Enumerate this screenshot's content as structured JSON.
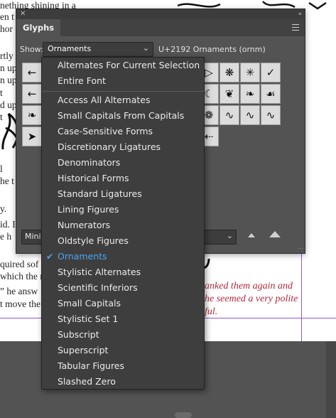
{
  "document": {
    "left_lines": [
      "nething shining in a",
      "en t",
      "hor",
      "rtly",
      "n up",
      "n up",
      "t",
      "d up",
      "t",
      "l",
      "he t",
      "y.",
      "id. I",
      "e h",
      "quired sof",
      "which the r",
      "” he answ",
      "t move the"
    ],
    "red_lines": [
      "anked them again and",
      "he seemed a very polite",
      "ful."
    ]
  },
  "panel": {
    "tab_label": "Glyphs",
    "close_glyph": "✕",
    "collapse_glyph": "«",
    "show_label": "Show:",
    "show_value": "Ornaments",
    "unicode_info": "U+2192 Ornaments (ornm)",
    "font_name": "Minic",
    "icons": {
      "menu": "panel-menu-icon",
      "zoom_out": "small-mountain-icon",
      "zoom_in": "large-mountain-icon"
    },
    "glyph_rows": [
      [
        "←",
        "",
        "",
        "",
        "",
        "",
        "",
        "",
        "▷",
        "❋",
        "✳",
        "✓"
      ],
      [
        "←",
        "",
        "",
        "",
        "",
        "",
        "",
        "",
        "☾",
        "❦",
        "❧",
        "☙"
      ],
      [
        "❧",
        "",
        "",
        "",
        "",
        "",
        "",
        "",
        "❁",
        "∿",
        "∿",
        "∿"
      ],
      [
        "➤",
        "",
        "",
        "",
        "",
        "",
        "",
        "",
        "⇠"
      ]
    ]
  },
  "dropdown": {
    "group1": [
      "Alternates For Current Selection",
      "Entire Font"
    ],
    "group2": [
      "Access All Alternates",
      "Small Capitals From Capitals",
      "Case-Sensitive Forms",
      "Discretionary Ligatures",
      "Denominators",
      "Historical Forms",
      "Standard Ligatures",
      "Lining Figures",
      "Numerators",
      "Oldstyle Figures",
      "Ornaments",
      "Stylistic Alternates",
      "Scientific Inferiors",
      "Small Capitals",
      "Stylistic Set 1",
      "Subscript",
      "Superscript",
      "Tabular Figures",
      "Slashed Zero"
    ],
    "selected": "Ornaments",
    "check_glyph": "✔"
  },
  "colors": {
    "panel_bg": "#535353",
    "dropdown_bg": "#3e3e3e",
    "selection_blue": "#4aa6f0",
    "doc_red": "#b12a3a",
    "guide_purple": "#8a5cd6"
  }
}
